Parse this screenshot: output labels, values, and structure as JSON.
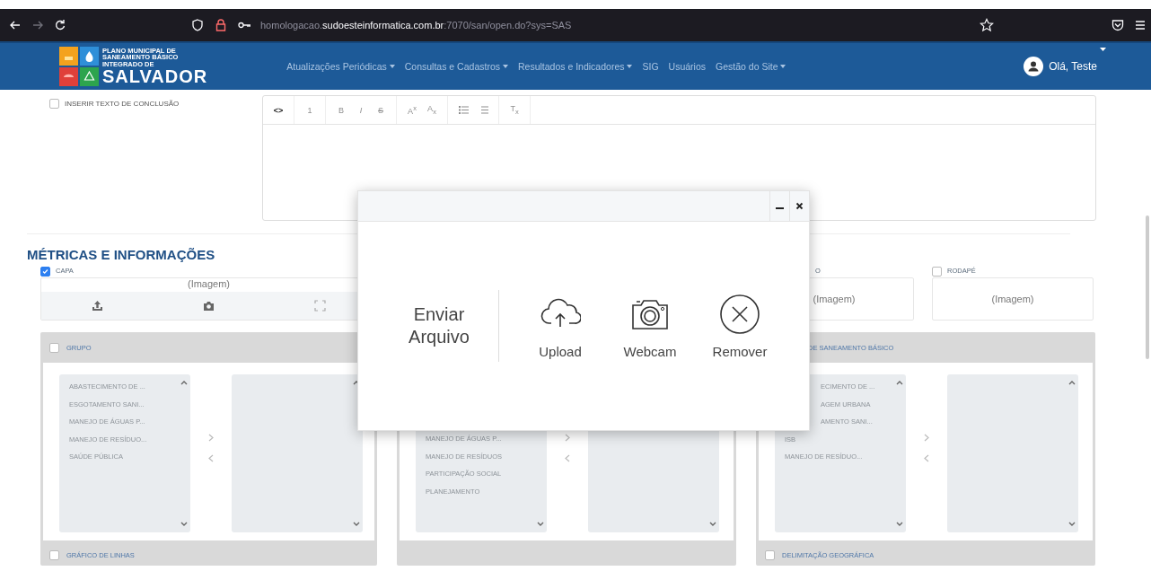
{
  "browser": {
    "url": "homologacao.**sudoesteinformatica.com.br**:7070/san/open.do?sys=SAS"
  },
  "navbar": {
    "logo": {
      "lines": [
        "PLANO MUNICIPAL DE",
        "SANEAMENTO BÁSICO",
        "INTEGRADO DE"
      ],
      "name": "SALVADOR"
    },
    "menu": [
      {
        "label": "Atualizações Periódicas",
        "dropdown": true
      },
      {
        "label": "Consultas e Cadastros",
        "dropdown": true
      },
      {
        "label": "Resultados e Indicadores",
        "dropdown": true
      },
      {
        "label": "SIG",
        "dropdown": false
      },
      {
        "label": "Usuários",
        "dropdown": false
      },
      {
        "label": "Gestão do Site",
        "dropdown": true
      }
    ],
    "user": {
      "greeting": "Olá, Teste"
    }
  },
  "conclusion": {
    "label": "INSERIR TEXTO DE CONCLUSÃO",
    "checked": false
  },
  "editor": {
    "tool_groups": [
      [
        {
          "kind": "code",
          "label": "<>",
          "disabled": false
        }
      ],
      [
        {
          "kind": "heading",
          "label": "1",
          "disabled": true
        }
      ],
      [
        {
          "kind": "bold",
          "label": "B",
          "disabled": true
        },
        {
          "kind": "italic",
          "label": "I",
          "disabled": true
        },
        {
          "kind": "strike",
          "label": "S",
          "disabled": true
        }
      ],
      [
        {
          "kind": "superscript",
          "label": "A$^{x}$",
          "disabled": true
        },
        {
          "kind": "subscript",
          "label": "A$_{x}$",
          "disabled": true
        }
      ],
      [
        {
          "kind": "bullets",
          "disabled": true
        },
        {
          "kind": "numbers",
          "disabled": true
        }
      ],
      [
        {
          "kind": "clear",
          "label": "T$_{x}$",
          "disabled": true
        }
      ]
    ]
  },
  "section_title": "MÉTRICAS E INFORMAÇÕES",
  "image_fields": [
    {
      "label": "CAPA",
      "checked": true,
      "kind": "actions",
      "text": "(Imagem)"
    },
    {
      "label": "O",
      "kind": "plain",
      "text": "(Imagem)"
    },
    {
      "label": "RODAPÉ",
      "checked": false,
      "kind": "plain",
      "text": "(Imagem)"
    }
  ],
  "panels": [
    {
      "title": "GRUPO",
      "checked": false,
      "available": [
        {
          "text": "ABASTECIMENTO DE ...",
          "kind": "whole"
        },
        {
          "text": "ESGOTAMENTO SANI...",
          "kind": "whole"
        },
        {
          "text": "MANEJO DE ÁGUAS P...",
          "kind": "whole"
        },
        {
          "text": "MANEJO DE RESÍDUO...",
          "kind": "whole"
        },
        {
          "text": "SAÚDE PÚBLICA",
          "kind": "whole"
        }
      ],
      "footer": {
        "label": "GRÁFICO DE LINHAS",
        "checked": false
      }
    },
    {
      "available": [
        {
          "text": "MANEJO DE ÁGUAS P...",
          "kind": "whole"
        },
        {
          "text": "MANEJO DE RESÍDUOS",
          "kind": "whole"
        },
        {
          "text": "PARTICIPAÇÃO SOCIAL",
          "kind": "whole"
        },
        {
          "text": "PLANEJAMENTO",
          "kind": "whole"
        }
      ]
    },
    {
      "title": "DE SANEAMENTO BÁSICO",
      "available": [
        {
          "text": "ECIMENTO DE ...",
          "kind": "clipped"
        },
        {
          "text": "AGEM URBANA",
          "kind": "clipped"
        },
        {
          "text": "AMENTO SANI...",
          "kind": "clipped"
        },
        {
          "text": "ISB",
          "kind": "whole"
        },
        {
          "text": "MANEJO DE RESÍDUO...",
          "kind": "whole"
        }
      ],
      "footer": {
        "label": "DELIMITAÇÃO GEOGRÁFICA",
        "checked": false
      }
    }
  ],
  "modal": {
    "heading": "Enviar Arquivo",
    "actions": [
      {
        "kind": "upload",
        "label": "Upload"
      },
      {
        "kind": "webcam",
        "label": "Webcam"
      },
      {
        "kind": "remove",
        "label": "Remover"
      }
    ]
  }
}
